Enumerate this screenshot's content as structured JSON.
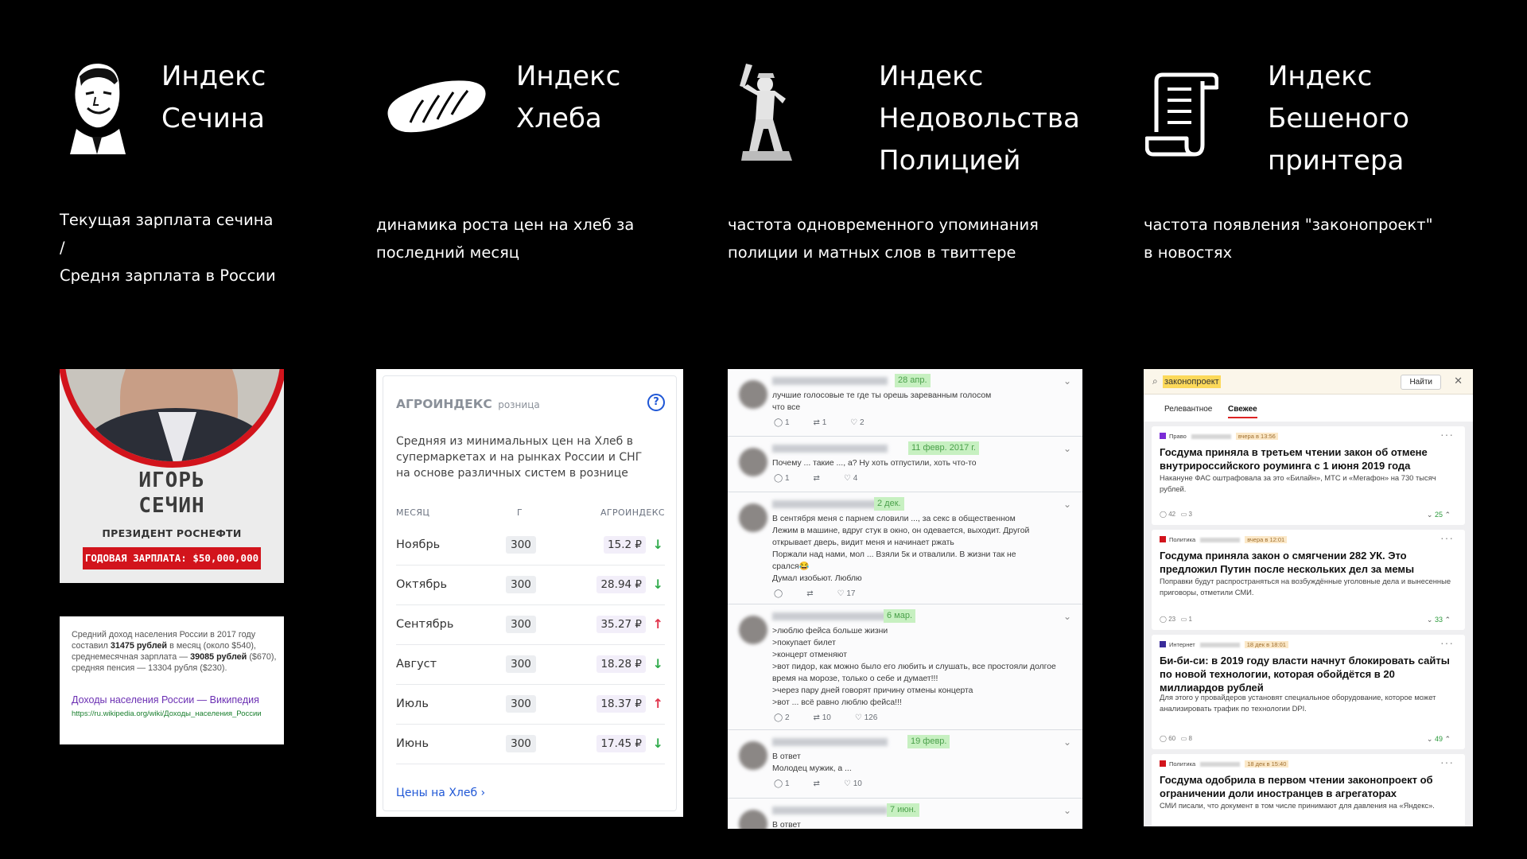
{
  "columns": [
    {
      "title": [
        "Индекс",
        "Сечина"
      ],
      "description": [
        "Текущая зарплата сечина",
        "/",
        "Средня зарплата в России"
      ]
    },
    {
      "title": [
        "Индекс",
        "Хлеба"
      ],
      "description": [
        "динамика роста цен на хлеб за",
        "последний месяц"
      ]
    },
    {
      "title": [
        "Индекс",
        "Недовольства",
        "Полицией"
      ],
      "description": [
        "частота одновременного упоминания",
        "полиции и матных слов в твиттере"
      ]
    },
    {
      "title": [
        "Индекс",
        "Бешеного",
        "принтера"
      ],
      "description": [
        "частота появления \"законопроект\"",
        "в новостях"
      ]
    }
  ],
  "sechin": {
    "name_line1": "ИГОРЬ",
    "name_line2": "СЕЧИН",
    "role": "ПРЕЗИДЕНТ РОСНЕФТИ",
    "salary": "ГОДОВАЯ ЗАРПЛАТА: $50,000,000",
    "wiki_t1": "Средний доход населения России в 2017 году составил",
    "wiki_b1": "31475 рублей",
    "wiki_t2": "в месяц (около $540), среднемесячная зарплата —",
    "wiki_b2": "39085 рублей",
    "wiki_t3": "($670), средняя пенсия — 13304 рубля ($230).",
    "wiki_link": "Доходы населения России — Википедия",
    "wiki_url": "https://ru.wikipedia.org/wiki/Доходы_населения_России"
  },
  "agro": {
    "title": "АГРОИНДЕКС",
    "subtitle": "розница",
    "help": "?",
    "description": "Средняя из минимальных цен на Хлеб в супермаркетах и на рынках России и СНГ на основе различных систем в рознице",
    "headers": {
      "month": "МЕСЯЦ",
      "g": "Г",
      "index": "АГРОИНДЕКС"
    },
    "rows": [
      {
        "month": "Ноябрь",
        "g": "300",
        "value": "15.2 ₽",
        "dir": "down"
      },
      {
        "month": "Октябрь",
        "g": "300",
        "value": "28.94 ₽",
        "dir": "down"
      },
      {
        "month": "Сентябрь",
        "g": "300",
        "value": "35.27 ₽",
        "dir": "up"
      },
      {
        "month": "Август",
        "g": "300",
        "value": "18.28 ₽",
        "dir": "down"
      },
      {
        "month": "Июль",
        "g": "300",
        "value": "18.37 ₽",
        "dir": "up"
      },
      {
        "month": "Июнь",
        "g": "300",
        "value": "17.45 ₽",
        "dir": "down"
      }
    ],
    "link": "Цены на Хлеб ›",
    "colors": {
      "down": "#2eaa4a",
      "up": "#e0334a"
    }
  },
  "tweets": [
    {
      "date": "28 апр.",
      "lines": [
        "лучшие голосовые те где ты орешь зареванным голосом",
        "что все"
      ],
      "reply": "1",
      "rt": "1",
      "like": "2"
    },
    {
      "date": "11 февр. 2017 г.",
      "lines": [
        "Почему ... такие ..., а? Ну хоть отпустили, хоть что-то"
      ],
      "reply": "1",
      "rt": "",
      "like": "4"
    },
    {
      "date": "2 дек.",
      "lines": [
        "В сентября меня с парнем словили ..., за секс в общественном",
        "Лежим в машине, вдруг стук в окно, он одевается, выходит. Другой",
        "открывает дверь, видит меня и начинает ржать",
        "Поржали над нами, мол ... Взяли 5к и отвалили. В жизни так не",
        "срался😂",
        "Думал изобьют. Люблю"
      ],
      "reply": "",
      "rt": "",
      "like": "17"
    },
    {
      "date": "6 мар.",
      "lines": [
        ">люблю фейса больше жизни",
        ">покупает билет",
        ">концерт отменяют",
        ">вот пидор, как можно было его любить и слушать, все простояли долгое",
        "время на морозе, только о себе и думает!!!",
        ">через пару дней говорят причину отмены концерта",
        ">вот ... всё равно люблю фейса!!!"
      ],
      "reply": "2",
      "rt": "10",
      "like": "126"
    },
    {
      "date": "19 февр.",
      "lines": [
        "В ответ",
        "Молодец мужик, а ..."
      ],
      "reply": "1",
      "rt": "",
      "like": "10"
    },
    {
      "date": "7 июн.",
      "lines": [
        "В ответ"
      ],
      "reply": "",
      "rt": "",
      "like": ""
    }
  ],
  "news": {
    "query": "законопроект",
    "search_button": "Найти",
    "tabs": [
      "Релевантное",
      "Свежее"
    ],
    "items": [
      {
        "source": "Право",
        "time": "вчера в 13:56",
        "color": "#7a2bd6",
        "headline": "Госдума приняла в третьем чтении закон об отмене внутрироссийского роуминга с 1 июня 2019 года",
        "summary": "Накануне ФАС оштрафовала за это «Билайн», МТС и «Мегафон» на 730 тысяч рублей.",
        "comments": "42",
        "saves": "3",
        "votes": "25"
      },
      {
        "source": "Политика",
        "time": "вчера в 12:01",
        "color": "#d2141c",
        "headline": "Госдума приняла закон о смягчении 282 УК. Это предложил Путин после нескольких дел за мемы",
        "summary": "Поправки будут распространяться на возбуждённые уголовные дела и вынесенные приговоры, отметили СМИ.",
        "comments": "23",
        "saves": "1",
        "votes": "33"
      },
      {
        "source": "Интернет",
        "time": "18 дек в 18:01",
        "color": "#3a2c9a",
        "headline": "Би-би-си: в 2019 году власти начнут блокировать сайты по новой технологии, которая обойдётся в 20 миллиардов рублей",
        "summary": "Для этого у провайдеров установят специальное оборудование, которое может анализировать трафик по технологии DPI.",
        "comments": "60",
        "saves": "8",
        "votes": "49"
      },
      {
        "source": "Политика",
        "time": "18 дек в 15:40",
        "color": "#d2141c",
        "headline": "Госдума одобрила в первом чтении законопроект об ограничении доли иностранцев в агрегаторах",
        "summary": "СМИ писали, что документ в том числе принимают для давления на «Яндекс».",
        "comments": "",
        "saves": "",
        "votes": ""
      }
    ]
  }
}
